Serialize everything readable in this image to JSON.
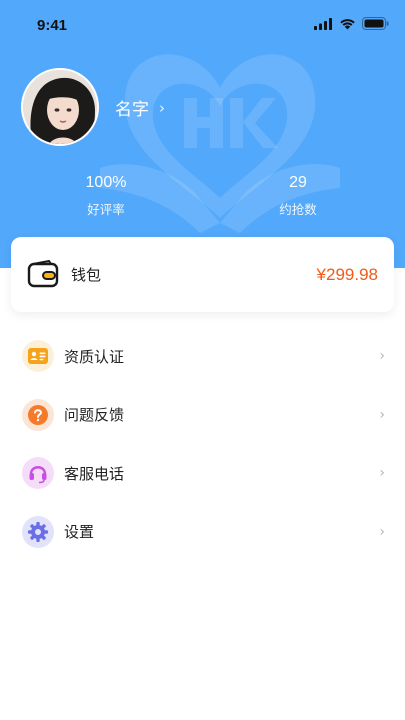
{
  "status_bar": {
    "time": "9:41"
  },
  "profile": {
    "name": "名字",
    "name_chevron": "›"
  },
  "stats": [
    {
      "value": "100%",
      "label": "好评率"
    },
    {
      "value": "29",
      "label": "约抢数"
    }
  ],
  "wallet": {
    "label": "钱包",
    "amount": "¥299.98"
  },
  "menu": {
    "items": [
      {
        "label": "资质认证",
        "icon": "id-card-icon",
        "color": "#f7a21b"
      },
      {
        "label": "问题反馈",
        "icon": "question-icon",
        "color": "#f57b2b"
      },
      {
        "label": "客服电话",
        "icon": "headset-icon",
        "color": "#c84fe0"
      },
      {
        "label": "设置",
        "icon": "gear-icon",
        "color": "#6b6fe6"
      }
    ],
    "chevron": "›"
  },
  "colors": {
    "header_bg": "#52a8fb",
    "amount": "#f25a17"
  }
}
